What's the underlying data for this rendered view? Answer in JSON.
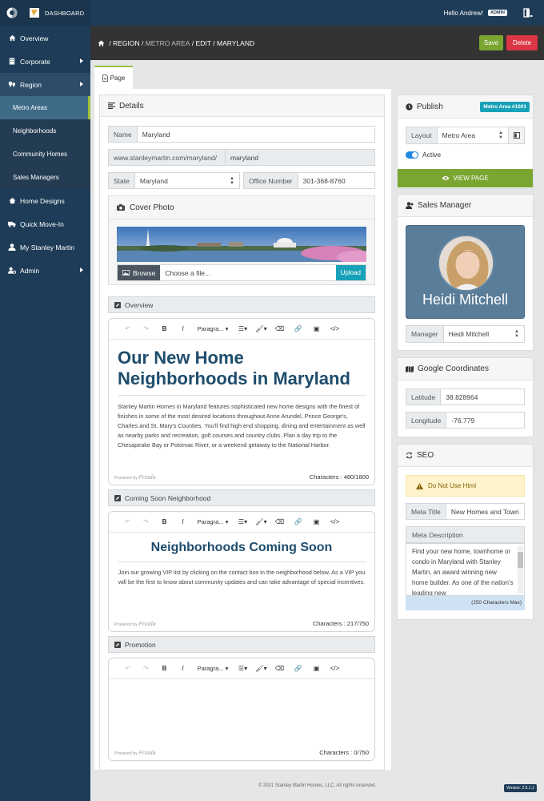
{
  "app": {
    "title": "DASHBOARD",
    "greeting": "Hello Andrew!",
    "role": "ADMIN"
  },
  "sidebar": {
    "items": [
      {
        "label": "Overview",
        "icon": "home-icon"
      },
      {
        "label": "Corporate",
        "icon": "building-icon"
      },
      {
        "label": "Region",
        "icon": "map-pins-icon"
      },
      {
        "label": "Home Designs",
        "icon": "house-icon"
      },
      {
        "label": "Quick Move-In",
        "icon": "truck-icon"
      },
      {
        "label": "My Stanley Martin",
        "icon": "user-icon"
      },
      {
        "label": "Admin",
        "icon": "user-gear-icon"
      }
    ],
    "region_sub": [
      {
        "label": "Metro Areas"
      },
      {
        "label": "Neighborhoods"
      },
      {
        "label": "Community Homes"
      },
      {
        "label": "Sales Managers"
      }
    ]
  },
  "breadcrumb": {
    "region": "REGION",
    "metro": "METRO AREA",
    "edit": "EDIT",
    "current": "MARYLAND"
  },
  "actions": {
    "save": "Save",
    "delete": "Delete"
  },
  "tab": {
    "label": "Page"
  },
  "details": {
    "title": "Details",
    "name_label": "Name",
    "name_value": "Maryland",
    "url_prefix": "www.stanleymartin.com/maryland/",
    "slug": "maryland",
    "state_label": "State",
    "state_value": "Maryland",
    "office_label": "Office Number",
    "office_value": "301-368-8760"
  },
  "cover": {
    "title": "Cover Photo",
    "browse": "Browse",
    "placeholder": "Choose a file...",
    "upload": "Upload"
  },
  "editor_toolbar": {
    "paragraph": "Paragra..."
  },
  "overview": {
    "label": "Overview",
    "heading": "Our New Home Neighborhoods in Maryland",
    "body": "Stanley Martin Homes in Maryland features sophisticated new home designs with the finest of finishes in some of the most desired locations throughout Anne Arundel, Prince George's, Charles and St. Mary's Counties. You'll find high end shopping, dining and entertainment as well as nearby parks and recreation, golf courses and country clubs. Plan a day trip to the Chesapeake Bay or Potomac River, or a weekend getaway to the National Harbor.",
    "chars": "Characters : 480/1800"
  },
  "coming_soon": {
    "label": "Coming Soon Neighborhood",
    "heading": "Neighborhoods Coming Soon",
    "body": "Join our growing VIP list by clicking on the contact box in the neighborhood below. As a VIP you will be the first to know about community updates and can take advantage of special incentives.",
    "chars": "Characters : 217/750"
  },
  "promotion": {
    "label": "Promotion",
    "chars": "Characters : 0/750"
  },
  "powered": {
    "text": "Powered by",
    "brand": "Froala"
  },
  "publish": {
    "title": "Publish",
    "badge": "Metro Area #1001",
    "layout_label": "Layout",
    "layout_value": "Metro Area",
    "active_label": "Active",
    "view_page": "VIEW PAGE"
  },
  "sales_manager": {
    "title": "Sales Manager",
    "name": "Heidi Mitchell",
    "manager_label": "Manager",
    "manager_value": "Heidi Mitchell"
  },
  "coords": {
    "title": "Google Coordinates",
    "lat_label": "Latitude",
    "lat_value": "38.828964",
    "lng_label": "Longitude",
    "lng_value": "-76.779"
  },
  "seo": {
    "title": "SEO",
    "warning": "Do Not Use Html",
    "meta_title_label": "Meta Title",
    "meta_title_value": "New Homes and Town",
    "meta_desc_label": "Meta Description",
    "meta_desc_value": "Find your new home, townhome or condo in Maryland with Stanley Martin, an award winning new home builder.  As one of the nation's leading new",
    "max": "(250 Characters Max)"
  },
  "footer": {
    "copyright": "© 2021 Stanley Martin Homes, LLC. All rights reserved.",
    "version": "Version: 2.5.1.1"
  },
  "colors": {
    "navy": "#1e3c57",
    "green": "#7aa531",
    "red": "#dc3545",
    "teal": "#17a2b8"
  }
}
